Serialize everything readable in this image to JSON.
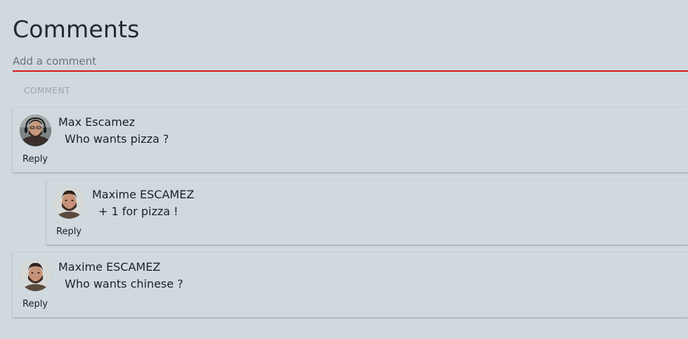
{
  "title": "Comments",
  "input": {
    "placeholder": "Add a comment",
    "underline_color": "#d21b1b"
  },
  "submit_label": "COMMENT",
  "comments": [
    {
      "author": "Max Escamez",
      "text": "Who wants pizza ?",
      "reply_label": "Reply",
      "avatar_icon": "avatar-bearded-man-headphones"
    },
    {
      "author": "Maxime ESCAMEZ",
      "text": "+ 1 for pizza !",
      "reply_label": "Reply",
      "avatar_icon": "avatar-bearded-man"
    },
    {
      "author": "Maxime ESCAMEZ",
      "text": "Who wants chinese ?",
      "reply_label": "Reply",
      "avatar_icon": "avatar-bearded-man"
    }
  ]
}
